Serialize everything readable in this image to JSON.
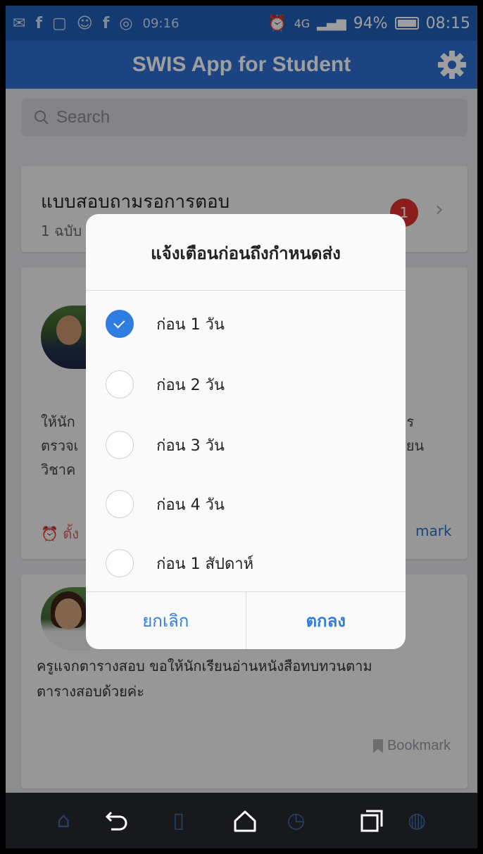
{
  "status_bar": {
    "battery": "94%",
    "time_left": "09:16",
    "time": "08:15",
    "network": "4G"
  },
  "header": {
    "title": "SWIS App for Student"
  },
  "search": {
    "placeholder": "Search"
  },
  "pending_card": {
    "title": "แบบสอบถามรอการตอบ",
    "subtitle": "1 ฉบับ",
    "badge_count": "1"
  },
  "post1": {
    "text_lines": [
      "ให้นัก",
      "ตรวจเ",
      "วิชาค"
    ],
    "text_right": [
      "าร",
      "รียน"
    ],
    "alarm_label": "ตั้ง",
    "bookmark_label": "mark"
  },
  "post2": {
    "text_lines": [
      "ครูแจกตารางสอบ ขอให้นักเรียนอ่านหนังสือทบทวนตาม",
      "ตารางสอบด้วยค่ะ"
    ],
    "bookmark_label": "Bookmark"
  },
  "dialog": {
    "title": "แจ้งเตือนก่อนถึงกำหนดส่ง",
    "options": [
      {
        "label": "ก่อน 1 วัน",
        "checked": true
      },
      {
        "label": "ก่อน 2 วัน",
        "checked": false
      },
      {
        "label": "ก่อน 3 วัน",
        "checked": false
      },
      {
        "label": "ก่อน 4 วัน",
        "checked": false
      },
      {
        "label": "ก่อน 1 สัปดาห์",
        "checked": false
      }
    ],
    "cancel_label": "ยกเลิก",
    "ok_label": "ตกลง"
  },
  "colors": {
    "accent": "#2f7de1",
    "header": "#2c6fd0",
    "badge": "#e03030"
  },
  "icons": [
    "back-icon",
    "home-icon",
    "recents-icon",
    "gear-icon",
    "search-icon",
    "bookmark-icon",
    "check-icon",
    "alarm-icon"
  ]
}
